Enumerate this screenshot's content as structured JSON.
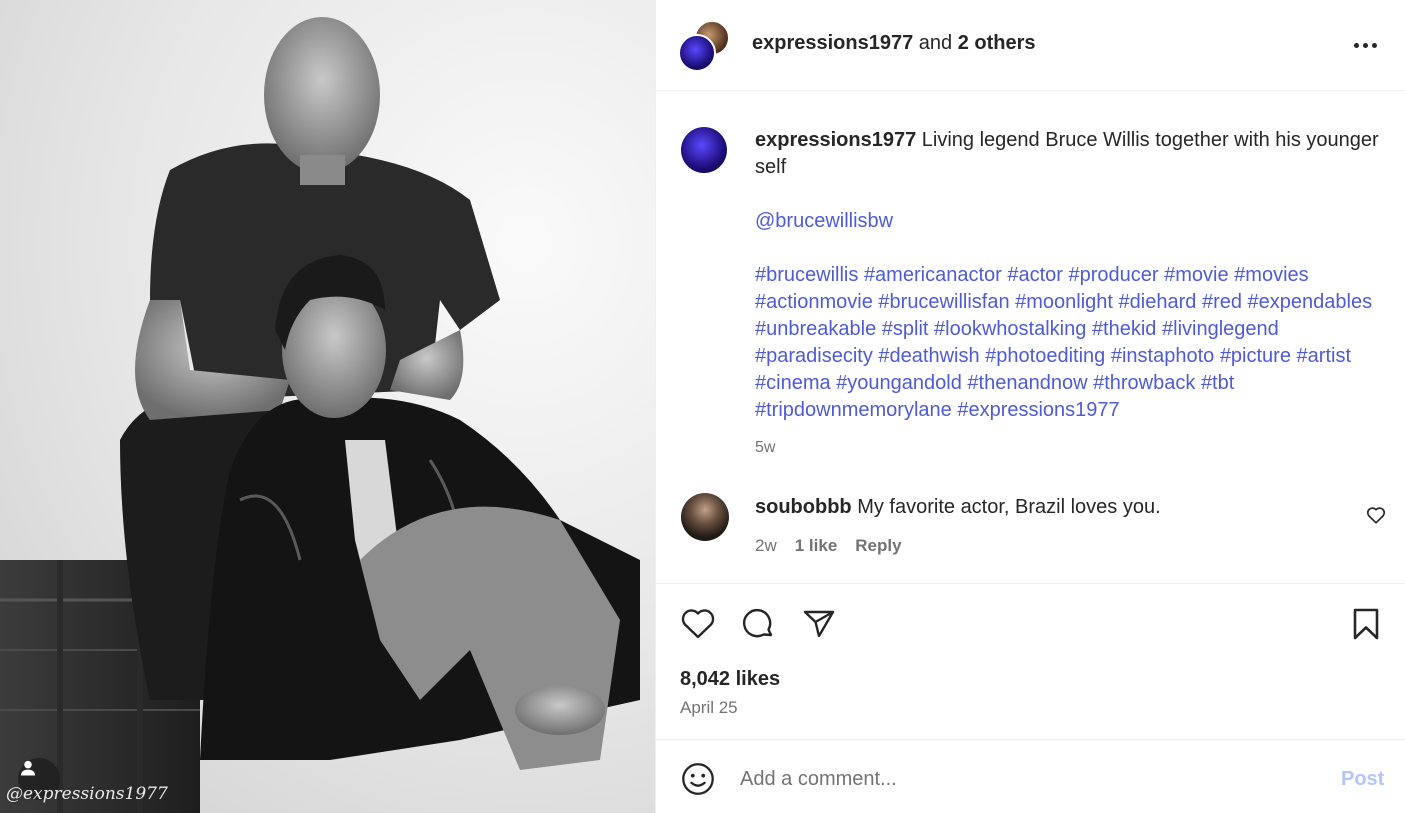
{
  "post": {
    "watermark": "@expressions1977",
    "owner": "expressions1977",
    "coauthors_conj": "and",
    "coauthors_rest": "2 others"
  },
  "caption": {
    "user": "expressions1977",
    "text": "Living legend Bruce Willis together with his younger self",
    "mention": "@brucewillisbw",
    "hashtags": [
      "#brucewillis",
      "#americanactor",
      "#actor",
      "#producer",
      "#movie",
      "#movies",
      "#actionmovie",
      "#brucewillisfan",
      "#moonlight",
      "#diehard",
      "#red",
      "#expendables",
      "#unbreakable",
      "#split",
      "#lookwhostalking",
      "#thekid",
      "#livinglegend",
      "#paradisecity",
      "#deathwish",
      "#photoediting",
      "#instaphoto",
      "#picture",
      "#artist",
      "#cinema",
      "#youngandold",
      "#thenandnow",
      "#throwback",
      "#tbt",
      "#tripdownmemorylane",
      "#expressions1977"
    ],
    "time": "5w"
  },
  "comments": [
    {
      "user": "soubobbb",
      "text": "My favorite actor, Brazil loves you.",
      "time": "2w",
      "likes": "1 like",
      "reply": "Reply"
    }
  ],
  "stats": {
    "likes": "8,042 likes",
    "date": "April 25"
  },
  "comment_box": {
    "placeholder": "Add a comment...",
    "post_label": "Post"
  },
  "icons": {
    "like": "heart-icon",
    "comment": "comment-icon",
    "share": "share-icon",
    "save": "bookmark-icon",
    "more": "more-options-icon",
    "emoji": "emoji-icon",
    "tag": "user-tag-icon"
  },
  "colors": {
    "link": "#4f5bd5",
    "post_disabled": "#b3c6f7",
    "muted": "#737373",
    "text": "#262626"
  }
}
